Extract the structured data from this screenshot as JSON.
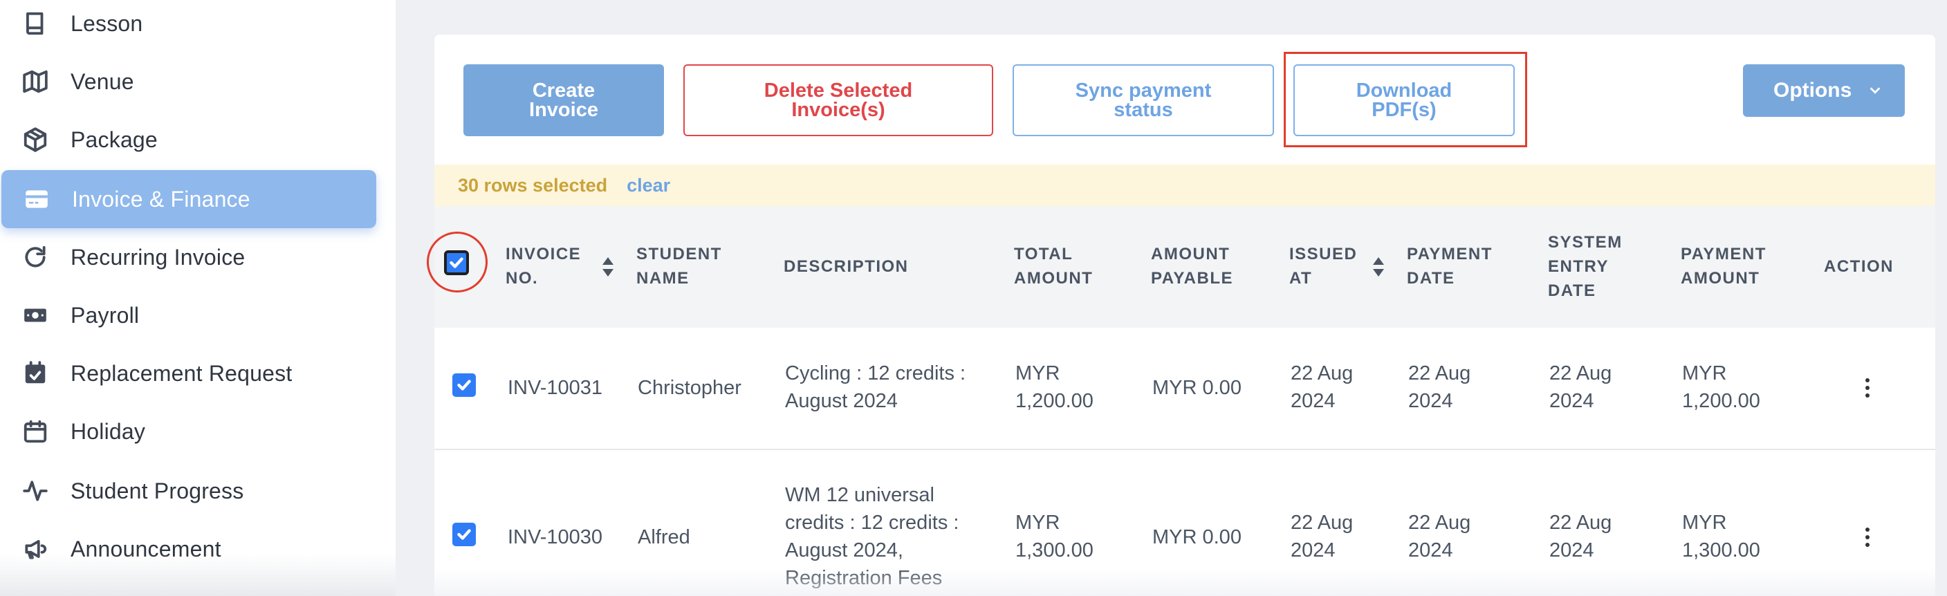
{
  "sidebar": {
    "items": [
      {
        "label": "Lesson",
        "icon": "book-icon"
      },
      {
        "label": "Venue",
        "icon": "map-icon"
      },
      {
        "label": "Package",
        "icon": "package-icon"
      },
      {
        "label": "Invoice & Finance",
        "icon": "credit-card-icon",
        "active": true
      },
      {
        "label": "Recurring Invoice",
        "icon": "refresh-icon"
      },
      {
        "label": "Payroll",
        "icon": "money-icon"
      },
      {
        "label": "Replacement Request",
        "icon": "calendar-check-icon"
      },
      {
        "label": "Holiday",
        "icon": "calendar-icon"
      },
      {
        "label": "Student Progress",
        "icon": "activity-icon"
      },
      {
        "label": "Announcement",
        "icon": "megaphone-icon"
      }
    ]
  },
  "toolbar": {
    "create_label": "Create Invoice",
    "delete_label": "Delete Selected Invoice(s)",
    "sync_label": "Sync payment status",
    "download_label": "Download PDF(s)",
    "options_label": "Options"
  },
  "selection": {
    "count_text": "30 rows selected",
    "clear_label": "clear"
  },
  "table": {
    "headers": {
      "invoice_no": "Invoice No.",
      "student_name": "Student Name",
      "description": "Description",
      "total_amount": "Total Amount",
      "amount_payable": "Amount Payable",
      "issued_at": "Issued At",
      "payment_date": "Payment Date",
      "system_entry_date": "System Entry Date",
      "payment_amount": "Payment Amount",
      "action": "Action"
    },
    "rows": [
      {
        "invoice_no": "INV-10031",
        "student_name": "Christopher",
        "description": "Cycling : 12 credits : August 2024",
        "total_amount": "MYR 1,200.00",
        "amount_payable": "MYR 0.00",
        "issued_at": "22 Aug 2024",
        "payment_date": "22 Aug 2024",
        "system_entry_date": "22 Aug 2024",
        "payment_amount": "MYR 1,200.00",
        "checked": true
      },
      {
        "invoice_no": "INV-10030",
        "student_name": "Alfred",
        "description": "WM 12 universal credits : 12 credits : August 2024, Registration Fees",
        "total_amount": "MYR 1,300.00",
        "amount_payable": "MYR 0.00",
        "issued_at": "22 Aug 2024",
        "payment_date": "22 Aug 2024",
        "system_entry_date": "22 Aug 2024",
        "payment_amount": "MYR 1,300.00",
        "checked": true
      }
    ]
  },
  "colors": {
    "accent": "#78a7dc",
    "active_nav": "#8fb8ec",
    "danger": "#e0464a",
    "highlight": "#e33d2c",
    "selection_bg": "#fdf6dd",
    "selection_text": "#c9a33a"
  }
}
